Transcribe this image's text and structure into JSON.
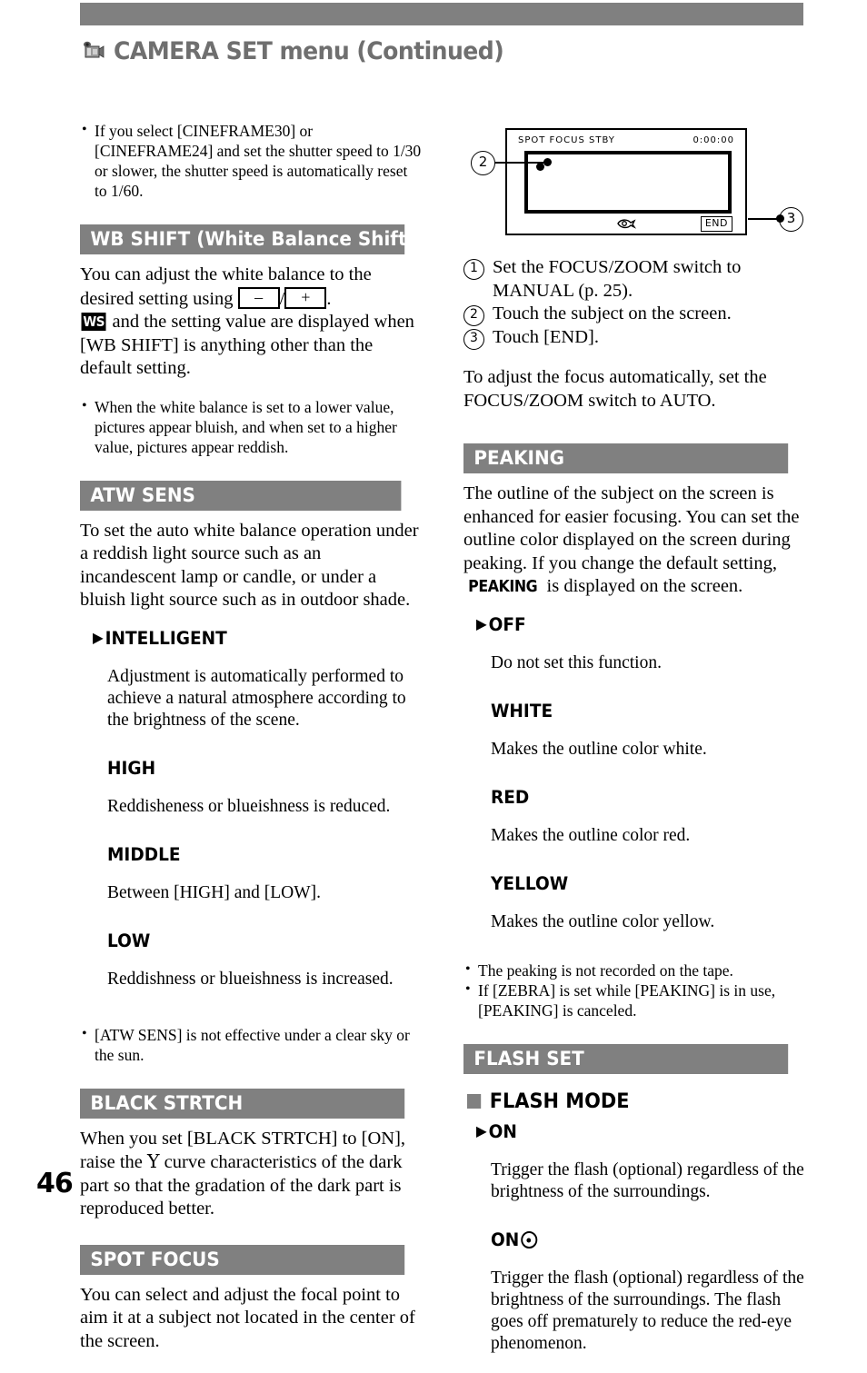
{
  "header": {
    "title": "CAMERA SET menu (Continued)",
    "icon": "camcorder-icon"
  },
  "page_number": "46",
  "left_column": {
    "intro_note": "If you select [CINEFRAME30] or [CINEFRAME24] and set the shutter speed to 1/30 or slower, the shutter speed is automatically reset to 1/60.",
    "wb_shift": {
      "heading": "WB SHIFT (White Balance Shift)",
      "body_part1": "You can adjust the white balance to the desired setting using ",
      "key_minus": "–",
      "key_slash": "/",
      "key_plus": "+",
      "body_part2": ".",
      "badge": "WS",
      "body_part3": " and the setting value are displayed when [WB SHIFT] is anything other than the default setting.",
      "note": "When the white balance is set to a lower value, pictures appear bluish, and when set to a higher value, pictures appear reddish."
    },
    "atw_sens": {
      "heading": "ATW SENS",
      "body": "To set the auto white balance operation under a reddish light source such as an incandescent lamp or candle, or under a bluish light source such as in outdoor shade.",
      "options": [
        {
          "label": "INTELLIGENT",
          "default": true,
          "desc": "Adjustment is automatically performed to achieve a natural atmosphere according to the brightness of the scene."
        },
        {
          "label": "HIGH",
          "default": false,
          "desc": "Reddisheness or blueishness is reduced."
        },
        {
          "label": "MIDDLE",
          "default": false,
          "desc": "Between [HIGH] and [LOW]."
        },
        {
          "label": "LOW",
          "default": false,
          "desc": "Reddishness or blueishness is increased."
        }
      ],
      "note": "[ATW SENS] is not effective under a clear sky or the sun."
    },
    "black_strtch": {
      "heading": "BLACK STRTCH",
      "body_part1": "When you set [BLACK STRTCH] to [ON], raise the ",
      "gamma": "Υ",
      "body_part2": " curve characteristics of the dark part so that the gradation of the dark part is reproduced better."
    },
    "spot_focus": {
      "heading": "SPOT FOCUS",
      "body": "You can select and adjust the focal point to aim it at a subject not located in the center of the screen."
    }
  },
  "right_column": {
    "diagram": {
      "status_text": "SPOT FOCUS   STBY",
      "timecode": "0:00:00",
      "end_button": "END",
      "callout_2": "2",
      "callout_3": "3",
      "focus_icon": "spot-focus-icon",
      "subject_dot": "subject-dot"
    },
    "steps": [
      {
        "num": "1",
        "text": "Set the FOCUS/ZOOM switch to MANUAL (p. 25)."
      },
      {
        "num": "2",
        "text": "Touch the subject on the screen."
      },
      {
        "num": "3",
        "text": "Touch [END]."
      }
    ],
    "after_steps": "To adjust the focus automatically, set the FOCUS/ZOOM switch to AUTO.",
    "peaking": {
      "heading": "PEAKING",
      "body_part1": "The outline of the subject on the screen is enhanced for easier focusing.  You can set the outline color displayed on the screen during peaking.  If you change the default setting, ",
      "inline_badge": "PEAKING",
      "body_part2": " is displayed on the screen.",
      "options": [
        {
          "label": "OFF",
          "default": true,
          "desc": "Do not set this function."
        },
        {
          "label": "WHITE",
          "default": false,
          "desc": "Makes the outline color white."
        },
        {
          "label": "RED",
          "default": false,
          "desc": "Makes the outline color red."
        },
        {
          "label": "YELLOW",
          "default": false,
          "desc": "Makes the outline color yellow."
        }
      ],
      "notes": [
        "The peaking is not recorded on the tape.",
        "If [ZEBRA] is set while [PEAKING] is in use, [PEAKING] is canceled."
      ]
    },
    "flash_set": {
      "heading": "FLASH SET",
      "sub_heading": "FLASH MODE",
      "options": [
        {
          "label": "ON",
          "default": true,
          "redeye": false,
          "desc": "Trigger the flash (optional) regardless of the brightness of the surroundings."
        },
        {
          "label": "ON",
          "default": false,
          "redeye": true,
          "desc": "Trigger the flash (optional) regardless of the brightness of the surroundings. The flash goes off prematurely to reduce the red-eye phenomenon."
        }
      ]
    }
  },
  "colors": {
    "bar_gray": "#808080",
    "title_gray": "#6f6f6f"
  }
}
